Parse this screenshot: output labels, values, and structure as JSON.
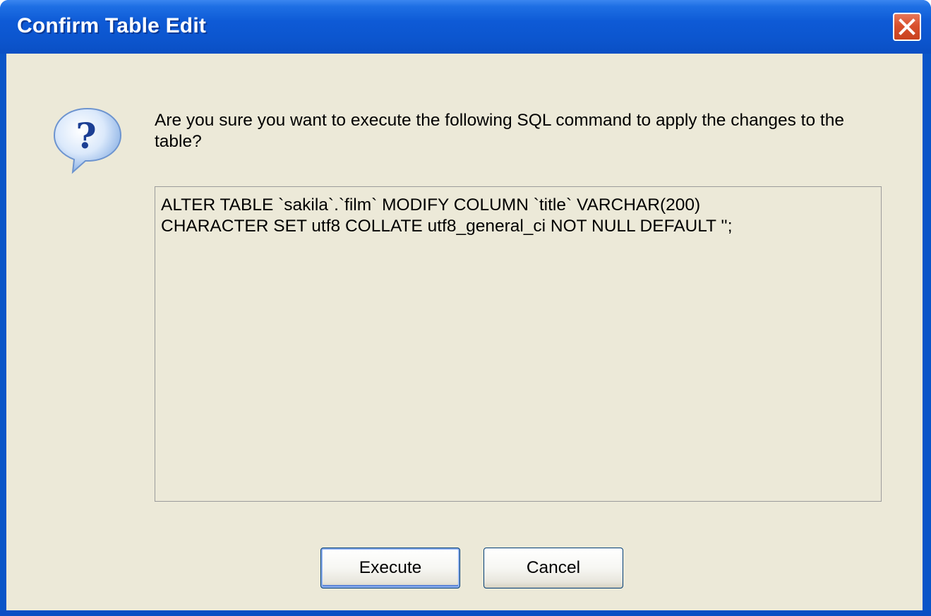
{
  "window": {
    "title": "Confirm Table Edit"
  },
  "icons": {
    "dialog_icon": "question-icon",
    "close_icon": "close-icon"
  },
  "dialog": {
    "message": "Are you sure you want to execute the following SQL command to apply the changes to the table?",
    "sql": "ALTER TABLE `sakila`.`film` MODIFY COLUMN `title` VARCHAR(200)\nCHARACTER SET utf8 COLLATE utf8_general_ci NOT NULL DEFAULT '';"
  },
  "buttons": {
    "execute_label": "Execute",
    "cancel_label": "Cancel"
  },
  "colors": {
    "titlebar": "#0a55c8",
    "client_background": "#ece9d8",
    "close_button": "#d9502d"
  }
}
